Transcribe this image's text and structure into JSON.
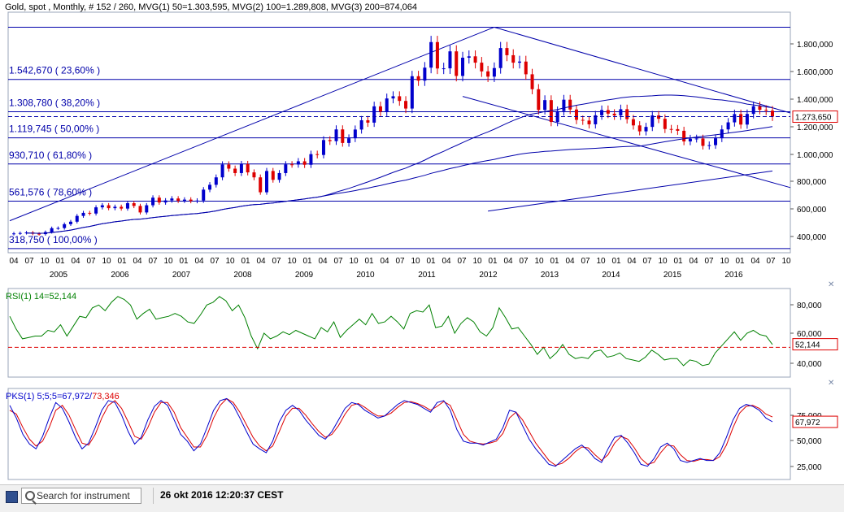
{
  "header": {
    "title": "Gold, spot , Monthly, # 152 / 260, MVG(1) 50=1.303,595, MVG(2) 100=1.289,808, MVG(3) 200=874,064"
  },
  "bottom_bar": {
    "search_placeholder": "Search for instrument",
    "datetime": "26 okt 2016 12:20:37 CEST"
  },
  "colors": {
    "price_line": "#0000aa",
    "up_candle": "#0000cc",
    "down_candle": "#dd0000",
    "rsi_line": "#008000",
    "stoch_k": "#0000cc",
    "stoch_d": "#dd0000",
    "last_value_box": "#dd0000"
  },
  "chart_data": [
    {
      "type": "candlestick",
      "title": "Gold, spot , Monthly, # 152 / 260, MVG(1) 50=1.303,595, MVG(2) 100=1.289,808, MVG(3) 200=874,064",
      "x_months": [
        "04",
        "07",
        "10",
        "01",
        "04",
        "07",
        "10",
        "01",
        "04",
        "07",
        "10",
        "01",
        "04",
        "07",
        "10",
        "01",
        "04",
        "07",
        "10",
        "01",
        "04",
        "07",
        "10",
        "01",
        "04",
        "07",
        "10",
        "01",
        "04",
        "07",
        "10",
        "01",
        "04",
        "07",
        "10",
        "01",
        "04",
        "07",
        "10",
        "01",
        "04",
        "07",
        "10",
        "01",
        "04",
        "07",
        "10",
        "01",
        "04",
        "07",
        "10"
      ],
      "x_years": [
        "2005",
        "2006",
        "2007",
        "2008",
        "2009",
        "2010",
        "2011",
        "2012",
        "2013",
        "2014",
        "2015",
        "2016"
      ],
      "y_ticks": [
        "1.800,000",
        "1.600,000",
        "1.400,000",
        "1.200,000",
        "1.000,000",
        "800,000",
        "600,000",
        "400,000"
      ],
      "ylim": [
        300,
        1950
      ],
      "last_value": "1.273,650",
      "last_value_num": 1273.65,
      "fib_levels": [
        {
          "label": "1.542,670 ( 23,60% )",
          "value": 1542.67
        },
        {
          "label": "1.308,780 ( 38,20% )",
          "value": 1308.78
        },
        {
          "label": "1.119,745 ( 50,00% )",
          "value": 1119.745
        },
        {
          "label": "930,710 ( 61,80% )",
          "value": 930.71
        },
        {
          "label": "561,576 ( 78,60% )",
          "value": 661.576
        },
        {
          "label": "318,750 ( 100,00% )",
          "value": 318.75
        }
      ],
      "fib_top": 1920.8,
      "closes": [
        428,
        431,
        435,
        426,
        423,
        438,
        466,
        467,
        495,
        513,
        555,
        577,
        572,
        617,
        632,
        611,
        621,
        608,
        647,
        627,
        580,
        632,
        687,
        652,
        667,
        681,
        665,
        673,
        663,
        666,
        745,
        780,
        834,
        927,
        897,
        865,
        930,
        870,
        834,
        726,
        880,
        816,
        865,
        928,
        927,
        950,
        925,
        1002,
        996,
        1104,
        1096,
        1181,
        1083,
        1117,
        1180,
        1247,
        1230,
        1348,
        1310,
        1405,
        1421,
        1387,
        1332,
        1566,
        1534,
        1628,
        1813,
        1622,
        1623,
        1746,
        1568,
        1700,
        1710,
        1664,
        1601,
        1563,
        1625,
        1770,
        1718,
        1664,
        1672,
        1580,
        1472,
        1322,
        1393,
        1235,
        1314,
        1396,
        1325,
        1250,
        1245,
        1218,
        1283,
        1321,
        1295,
        1282,
        1327,
        1255,
        1210,
        1167,
        1199,
        1282,
        1258,
        1184,
        1183,
        1171,
        1094,
        1114,
        1115,
        1062,
        1067,
        1117,
        1181,
        1232,
        1292,
        1216,
        1293,
        1349,
        1323,
        1317,
        1274
      ],
      "candles_note": "",
      "trendlines": [],
      "mvg50": [],
      "mvg100": [],
      "mvg200": []
    },
    {
      "type": "line",
      "title": "RSI(1) 14=52,144",
      "y_ticks": [
        "80,000",
        "60,000",
        "40,000"
      ],
      "ylim": [
        30,
        90
      ],
      "reference_value": 50,
      "last_value": "52,144",
      "last_value_num": 52.144,
      "values": [
        72,
        63,
        56,
        57,
        58,
        58,
        62,
        61,
        66,
        58,
        65,
        72,
        71,
        78,
        80,
        76,
        82,
        86,
        84,
        80,
        70,
        74,
        77,
        70,
        71,
        72,
        74,
        72,
        68,
        67,
        73,
        80,
        82,
        86,
        83,
        76,
        80,
        71,
        58,
        49,
        60,
        56,
        58,
        61,
        59,
        62,
        60,
        58,
        56,
        64,
        61,
        68,
        57,
        62,
        66,
        70,
        66,
        74,
        67,
        68,
        72,
        68,
        63,
        74,
        76,
        75,
        80,
        64,
        65,
        72,
        60,
        67,
        71,
        68,
        61,
        58,
        64,
        78,
        71,
        63,
        64,
        58,
        52,
        45,
        50,
        42,
        46,
        52,
        45,
        42,
        43,
        42,
        47,
        48,
        43,
        44,
        46,
        42,
        41,
        40,
        43,
        48,
        45,
        41,
        42,
        42,
        37,
        41,
        40,
        37,
        38,
        46,
        51,
        56,
        61,
        55,
        60,
        62,
        59,
        58,
        52
      ]
    },
    {
      "type": "line",
      "title": "PKS(1) 5;5;5=67,972/73,346",
      "y_ticks": [
        "75,000",
        "50,000",
        "25,000"
      ],
      "ylim": [
        10,
        100
      ],
      "last_value": "67,972",
      "k_last": 67.972,
      "d_last": 73.346,
      "series": [
        {
          "name": "67,972",
          "values": [
            85,
            72,
            55,
            45,
            40,
            53,
            72,
            88,
            82,
            68,
            52,
            40,
            46,
            62,
            80,
            90,
            88,
            75,
            58,
            45,
            52,
            70,
            84,
            90,
            85,
            70,
            55,
            48,
            38,
            45,
            62,
            80,
            90,
            92,
            85,
            72,
            58,
            45,
            40,
            36,
            48,
            68,
            80,
            85,
            80,
            70,
            62,
            54,
            50,
            58,
            70,
            82,
            88,
            86,
            80,
            76,
            72,
            74,
            80,
            86,
            90,
            88,
            86,
            82,
            78,
            88,
            90,
            80,
            60,
            48,
            46,
            46,
            44,
            47,
            50,
            62,
            80,
            78,
            64,
            50,
            40,
            32,
            24,
            22,
            28,
            34,
            40,
            44,
            38,
            30,
            26,
            40,
            52,
            54,
            46,
            36,
            24,
            22,
            30,
            42,
            46,
            40,
            28,
            26,
            28,
            30,
            28,
            28,
            36,
            52,
            70,
            82,
            86,
            84,
            80,
            72,
            68
          ]
        },
        {
          "name": "73,346",
          "values": [
            80,
            76,
            62,
            50,
            43,
            48,
            62,
            80,
            85,
            75,
            60,
            46,
            44,
            55,
            72,
            85,
            90,
            82,
            68,
            53,
            50,
            62,
            78,
            88,
            88,
            78,
            62,
            52,
            42,
            42,
            54,
            72,
            85,
            92,
            88,
            78,
            65,
            52,
            43,
            38,
            43,
            58,
            74,
            82,
            82,
            75,
            66,
            58,
            52,
            55,
            64,
            76,
            85,
            87,
            83,
            78,
            74,
            74,
            77,
            83,
            88,
            89,
            87,
            84,
            80,
            84,
            89,
            85,
            70,
            55,
            48,
            46,
            45,
            46,
            48,
            56,
            72,
            78,
            70,
            58,
            46,
            37,
            28,
            23,
            25,
            30,
            37,
            42,
            41,
            34,
            28,
            34,
            46,
            53,
            50,
            41,
            30,
            24,
            26,
            36,
            44,
            43,
            34,
            28,
            27,
            29,
            29,
            28,
            32,
            44,
            62,
            77,
            84,
            85,
            82,
            76,
            73
          ]
        }
      ]
    }
  ]
}
